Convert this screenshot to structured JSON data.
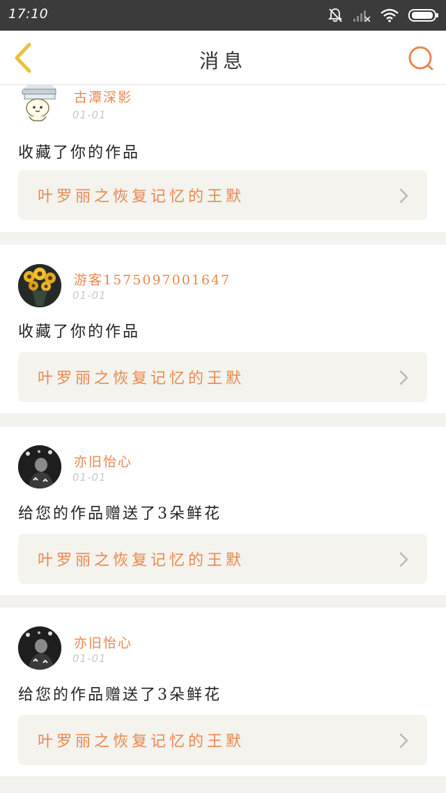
{
  "status_bar": {
    "time": "17:10",
    "icons": [
      "bell-muted-icon",
      "signal-icon",
      "wifi-icon",
      "battery-icon"
    ]
  },
  "header": {
    "title": "消息",
    "back_icon": "chevron-left-icon",
    "search_icon": "search-icon",
    "accent_color": "#e8884f",
    "back_color": "#e8c23a"
  },
  "messages": [
    {
      "username": "古潭深影",
      "date": "01-01",
      "action": "收藏了你的作品",
      "work_title": "叶罗丽之恢复记忆的王默",
      "avatar": "cartoon-books-avatar"
    },
    {
      "username": "游客1575097001647",
      "date": "01-01",
      "action": "收藏了你的作品",
      "work_title": "叶罗丽之恢复记忆的王默",
      "avatar": "sunflowers-avatar"
    },
    {
      "username": "亦旧怡心",
      "date": "01-01",
      "action": "给您的作品赠送了3朵鲜花",
      "work_title": "叶罗丽之恢复记忆的王默",
      "avatar": "bw-portrait-avatar"
    },
    {
      "username": "亦旧怡心",
      "date": "01-01",
      "action": "给您的作品赠送了3朵鲜花",
      "work_title": "叶罗丽之恢复记忆的王默",
      "avatar": "bw-portrait-avatar"
    }
  ]
}
